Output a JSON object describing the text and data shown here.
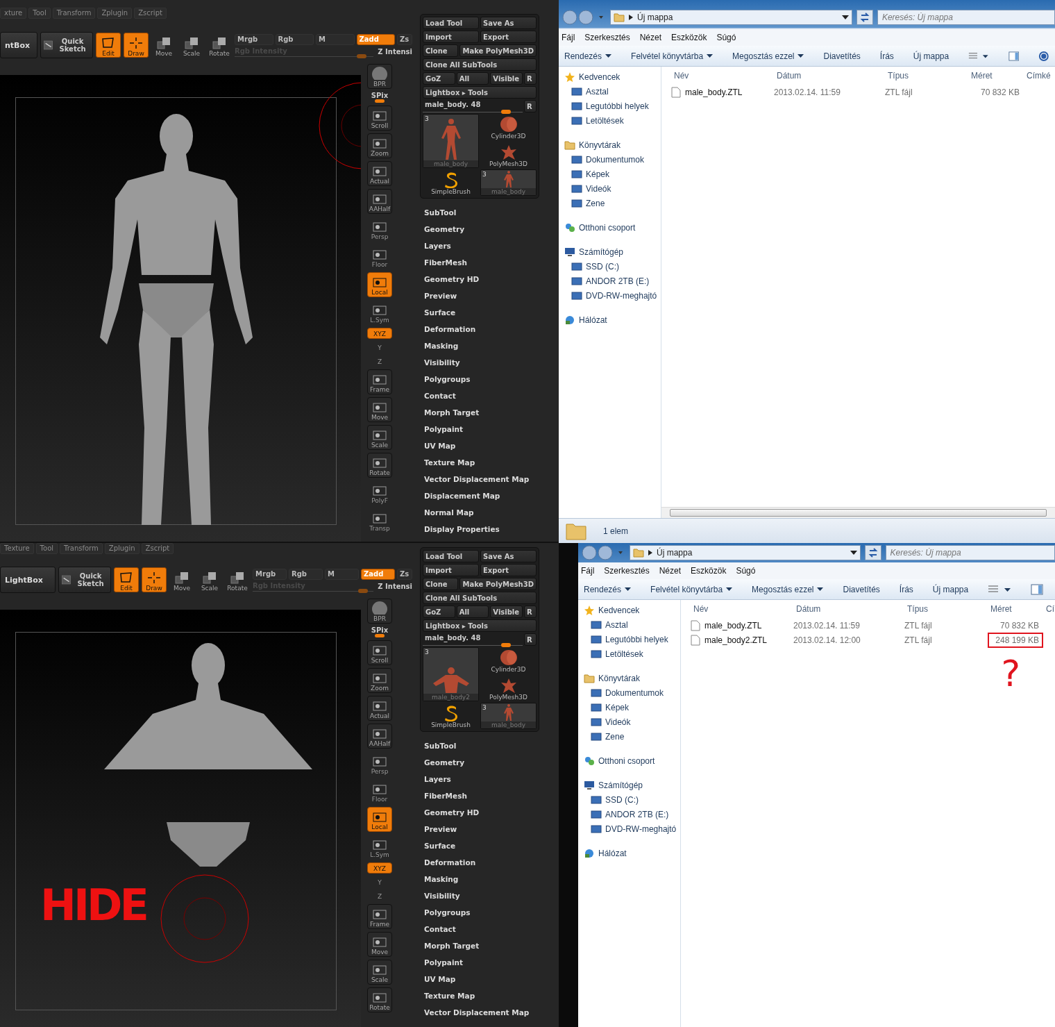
{
  "screens": [
    {
      "zbrush": {
        "menu_rows": [
          [
            "xture",
            "Tool",
            "Transform",
            "Zplugin",
            "Zscript"
          ]
        ],
        "lightbox": "ntBox",
        "quick_sketch": "Quick Sketch",
        "tools": [
          {
            "label": "Edit",
            "kind": "edit",
            "on": true
          },
          {
            "label": "Draw",
            "kind": "draw",
            "on": true
          },
          {
            "label": "Move",
            "kind": "move",
            "on": false
          },
          {
            "label": "Scale",
            "kind": "scale",
            "on": false
          },
          {
            "label": "Rotate",
            "kind": "rotate",
            "on": false
          }
        ],
        "modes": [
          {
            "label": "Mrgb",
            "on": false
          },
          {
            "label": "Rgb",
            "on": false
          },
          {
            "label": "M",
            "on": false
          },
          {
            "label": "Zadd",
            "on": true
          },
          {
            "label": "Zs",
            "on": false
          }
        ],
        "rgb_intensity": {
          "label": "Rgb Intensity",
          "level": 0.95
        },
        "z_intensity": "Z Intensi",
        "canvas": {
          "legs_hidden": false
        },
        "shelf": [
          {
            "label": "BPR",
            "kind": "sphere",
            "on": false
          },
          {
            "label": "SPix",
            "kind": "slider",
            "on": false
          },
          {
            "label": "Scroll",
            "kind": "button",
            "on": false
          },
          {
            "label": "Zoom",
            "kind": "button",
            "on": false
          },
          {
            "label": "Actual",
            "kind": "button",
            "on": false
          },
          {
            "label": "AAHalf",
            "kind": "button",
            "on": false
          },
          {
            "label": "Persp",
            "kind": "flat",
            "on": false
          },
          {
            "label": "Floor",
            "kind": "flat",
            "on": false
          },
          {
            "label": "Local",
            "kind": "button",
            "on": true
          },
          {
            "label": "L.Sym",
            "kind": "flat",
            "on": false
          },
          {
            "label": "XYZ",
            "kind": "small",
            "on": true
          },
          {
            "label": "Y",
            "kind": "tiny",
            "on": false
          },
          {
            "label": "Z",
            "kind": "tiny",
            "on": false
          },
          {
            "label": "Frame",
            "kind": "button",
            "on": false
          },
          {
            "label": "Move",
            "kind": "button",
            "on": false
          },
          {
            "label": "Scale",
            "kind": "button",
            "on": false
          },
          {
            "label": "Rotate",
            "kind": "button",
            "on": false
          },
          {
            "label": "PolyF",
            "kind": "flat",
            "on": false
          },
          {
            "label": "Transp",
            "kind": "flat",
            "on": false
          }
        ],
        "button_rows": [
          [
            "Load Tool",
            "Save As"
          ],
          [
            "Import",
            "Export"
          ],
          [
            "Clone",
            "Make PolyMesh3D"
          ],
          [
            "Clone All SubTools"
          ],
          [
            "GoZ",
            "All",
            "Visible",
            "R"
          ],
          [
            "Lightbox ▸ Tools"
          ]
        ],
        "tool_slider": {
          "label": "male_body. 48",
          "level": 0.88,
          "reset": "R"
        },
        "thumbnails": [
          {
            "label": "male_body",
            "kind": "figure",
            "count": "3"
          },
          {
            "label": "Cylinder3D",
            "kind": "cylinder"
          },
          {
            "label": "PolyMesh3D",
            "kind": "star"
          },
          {
            "label": "SimpleBrush",
            "kind": "brush"
          },
          {
            "label": "male_body",
            "kind": "figure_small",
            "count": "3"
          }
        ],
        "sections": [
          "SubTool",
          "Geometry",
          "Layers",
          "FiberMesh",
          "Geometry HD",
          "Preview",
          "Surface",
          "Deformation",
          "Masking",
          "Visibility",
          "Polygroups",
          "Contact",
          "Morph Target",
          "Polypaint",
          "UV Map",
          "Texture Map",
          "Vector Displacement Map",
          "Displacement Map",
          "Normal Map",
          "Display Properties"
        ]
      },
      "explorer": {
        "path": "Új mappa",
        "search_placeholder": "Keresés: Új mappa",
        "menu": [
          "Fájl",
          "Szerkesztés",
          "Nézet",
          "Eszközök",
          "Súgó"
        ],
        "toolbar": [
          {
            "label": "Rendezés",
            "dropdown": true
          },
          {
            "label": "Felvétel könyvtárba",
            "dropdown": true
          },
          {
            "label": "Megosztás ezzel",
            "dropdown": true
          },
          {
            "label": "Diavetítés",
            "dropdown": false
          },
          {
            "label": "Írás",
            "dropdown": false
          },
          {
            "label": "Új mappa",
            "dropdown": false
          }
        ],
        "nav": [
          {
            "label": "Kedvencek",
            "kind": "star",
            "children": [
              {
                "label": "Asztal"
              },
              {
                "label": "Legutóbbi helyek"
              },
              {
                "label": "Letöltések"
              }
            ]
          },
          {
            "label": "Könyvtárak",
            "kind": "folder",
            "children": [
              {
                "label": "Dokumentumok"
              },
              {
                "label": "Képek"
              },
              {
                "label": "Videók"
              },
              {
                "label": "Zene"
              }
            ]
          },
          {
            "label": "Otthoni csoport",
            "kind": "home"
          },
          {
            "label": "Számítógép",
            "kind": "computer",
            "children": [
              {
                "label": "SSD (C:)"
              },
              {
                "label": "ANDOR 2TB (E:)"
              },
              {
                "label": "DVD-RW-meghajtó"
              }
            ]
          },
          {
            "label": "Hálózat",
            "kind": "network"
          }
        ],
        "columns": [
          "Név",
          "Dátum",
          "Típus",
          "Méret",
          "Címké"
        ],
        "files": [
          {
            "name": "male_body.ZTL",
            "date": "2013.02.14. 11:59",
            "type": "ZTL fájl",
            "size": "70 832 KB",
            "circled": false
          }
        ],
        "status": "1 elem"
      }
    },
    {
      "zbrush": {
        "menu_rows": [
          [
            "Texture",
            "Tool",
            "Transform",
            "Zplugin",
            "Zscript"
          ]
        ],
        "lightbox": "LightBox",
        "quick_sketch": "Quick Sketch",
        "tools": [
          {
            "label": "Edit",
            "kind": "edit",
            "on": true
          },
          {
            "label": "Draw",
            "kind": "draw",
            "on": true
          },
          {
            "label": "Move",
            "kind": "move",
            "on": false
          },
          {
            "label": "Scale",
            "kind": "scale",
            "on": false
          },
          {
            "label": "Rotate",
            "kind": "rotate",
            "on": false
          }
        ],
        "modes": [
          {
            "label": "Mrgb",
            "on": false
          },
          {
            "label": "Rgb",
            "on": false
          },
          {
            "label": "M",
            "on": false
          },
          {
            "label": "Zadd",
            "on": true
          },
          {
            "label": "Zs",
            "on": false
          }
        ],
        "rgb_intensity": {
          "label": "Rgb Intensity",
          "level": 0.95
        },
        "z_intensity": "Z Intensi",
        "canvas": {
          "legs_hidden": true,
          "annotation": "HIDE"
        },
        "shelf": [
          {
            "label": "BPR",
            "kind": "sphere",
            "on": false
          },
          {
            "label": "SPix",
            "kind": "slider",
            "on": false
          },
          {
            "label": "Scroll",
            "kind": "button",
            "on": false
          },
          {
            "label": "Zoom",
            "kind": "button",
            "on": false
          },
          {
            "label": "Actual",
            "kind": "button",
            "on": false
          },
          {
            "label": "AAHalf",
            "kind": "button",
            "on": false
          },
          {
            "label": "Persp",
            "kind": "flat",
            "on": false
          },
          {
            "label": "Floor",
            "kind": "flat",
            "on": false
          },
          {
            "label": "Local",
            "kind": "button",
            "on": true
          },
          {
            "label": "L.Sym",
            "kind": "flat",
            "on": false
          },
          {
            "label": "XYZ",
            "kind": "small",
            "on": true
          },
          {
            "label": "Y",
            "kind": "tiny",
            "on": false
          },
          {
            "label": "Z",
            "kind": "tiny",
            "on": false
          },
          {
            "label": "Frame",
            "kind": "button",
            "on": false
          },
          {
            "label": "Move",
            "kind": "button",
            "on": false
          },
          {
            "label": "Scale",
            "kind": "button",
            "on": false
          },
          {
            "label": "Rotate",
            "kind": "button",
            "on": false
          }
        ],
        "button_rows": [
          [
            "Load Tool",
            "Save As"
          ],
          [
            "Import",
            "Export"
          ],
          [
            "Clone",
            "Make PolyMesh3D"
          ],
          [
            "Clone All SubTools"
          ],
          [
            "GoZ",
            "All",
            "Visible",
            "R"
          ],
          [
            "Lightbox ▸ Tools"
          ]
        ],
        "tool_slider": {
          "label": "male_body. 48",
          "level": 0.88,
          "reset": "R"
        },
        "thumbnails": [
          {
            "label": "male_body2",
            "kind": "torso",
            "count": "3"
          },
          {
            "label": "Cylinder3D",
            "kind": "cylinder"
          },
          {
            "label": "PolyMesh3D",
            "kind": "star"
          },
          {
            "label": "SimpleBrush",
            "kind": "brush"
          },
          {
            "label": "male_body",
            "kind": "figure_small",
            "count": "3"
          }
        ],
        "sections": [
          "SubTool",
          "Geometry",
          "Layers",
          "FiberMesh",
          "Geometry HD",
          "Preview",
          "Surface",
          "Deformation",
          "Masking",
          "Visibility",
          "Polygroups",
          "Contact",
          "Morph Target",
          "Polypaint",
          "UV Map",
          "Texture Map",
          "Vector Displacement Map"
        ]
      },
      "explorer": {
        "path": "Új mappa",
        "search_placeholder": "Keresés: Új mappa",
        "menu": [
          "Fájl",
          "Szerkesztés",
          "Nézet",
          "Eszközök",
          "Súgó"
        ],
        "toolbar": [
          {
            "label": "Rendezés",
            "dropdown": true
          },
          {
            "label": "Felvétel könyvtárba",
            "dropdown": true
          },
          {
            "label": "Megosztás ezzel",
            "dropdown": true
          },
          {
            "label": "Diavetítés",
            "dropdown": false
          },
          {
            "label": "Írás",
            "dropdown": false
          },
          {
            "label": "Új mappa",
            "dropdown": false
          }
        ],
        "nav": [
          {
            "label": "Kedvencek",
            "kind": "star",
            "children": [
              {
                "label": "Asztal"
              },
              {
                "label": "Legutóbbi helyek"
              },
              {
                "label": "Letöltések"
              }
            ]
          },
          {
            "label": "Könyvtárak",
            "kind": "folder",
            "children": [
              {
                "label": "Dokumentumok"
              },
              {
                "label": "Képek"
              },
              {
                "label": "Videók"
              },
              {
                "label": "Zene"
              }
            ]
          },
          {
            "label": "Otthoni csoport",
            "kind": "home"
          },
          {
            "label": "Számítógép",
            "kind": "computer",
            "children": [
              {
                "label": "SSD (C:)"
              },
              {
                "label": "ANDOR 2TB (E:)"
              },
              {
                "label": "DVD-RW-meghajtó"
              }
            ]
          },
          {
            "label": "Hálózat",
            "kind": "network"
          }
        ],
        "columns": [
          "Név",
          "Dátum",
          "Típus",
          "Méret",
          "Cí"
        ],
        "files": [
          {
            "name": "male_body.ZTL",
            "date": "2013.02.14. 11:59",
            "type": "ZTL fájl",
            "size": "70 832 KB",
            "circled": false
          },
          {
            "name": "male_body2.ZTL",
            "date": "2013.02.14. 12:00",
            "type": "ZTL fájl",
            "size": "248 199 KB",
            "circled": true
          }
        ],
        "annotation": "?"
      }
    }
  ]
}
